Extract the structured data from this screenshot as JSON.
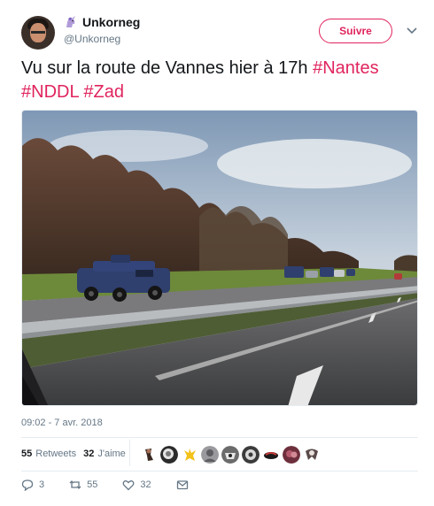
{
  "author": {
    "display_name": "Unkorneg",
    "handle": "@Unkorneg",
    "badge_icon": "unicorn-icon"
  },
  "follow_button": {
    "label": "Suivre"
  },
  "menu_icon": "chevron-down-icon",
  "tweet": {
    "text_plain": "Vu sur la route de Vannes hier à 17h ",
    "hashtags": [
      "#Nantes",
      "#NDDL",
      "#Zad"
    ]
  },
  "timestamp": "09:02 - 7 avr. 2018",
  "stats": {
    "retweets_count": "55",
    "retweets_label": "Retweets",
    "likes_count": "32",
    "likes_label": "J'aime"
  },
  "actions": {
    "reply_count": "3",
    "retweet_count": "55",
    "like_count": "32"
  },
  "colors": {
    "accent": "#e0245e",
    "text": "#14171a",
    "muted": "#657786",
    "divider": "#e6ecf0"
  }
}
